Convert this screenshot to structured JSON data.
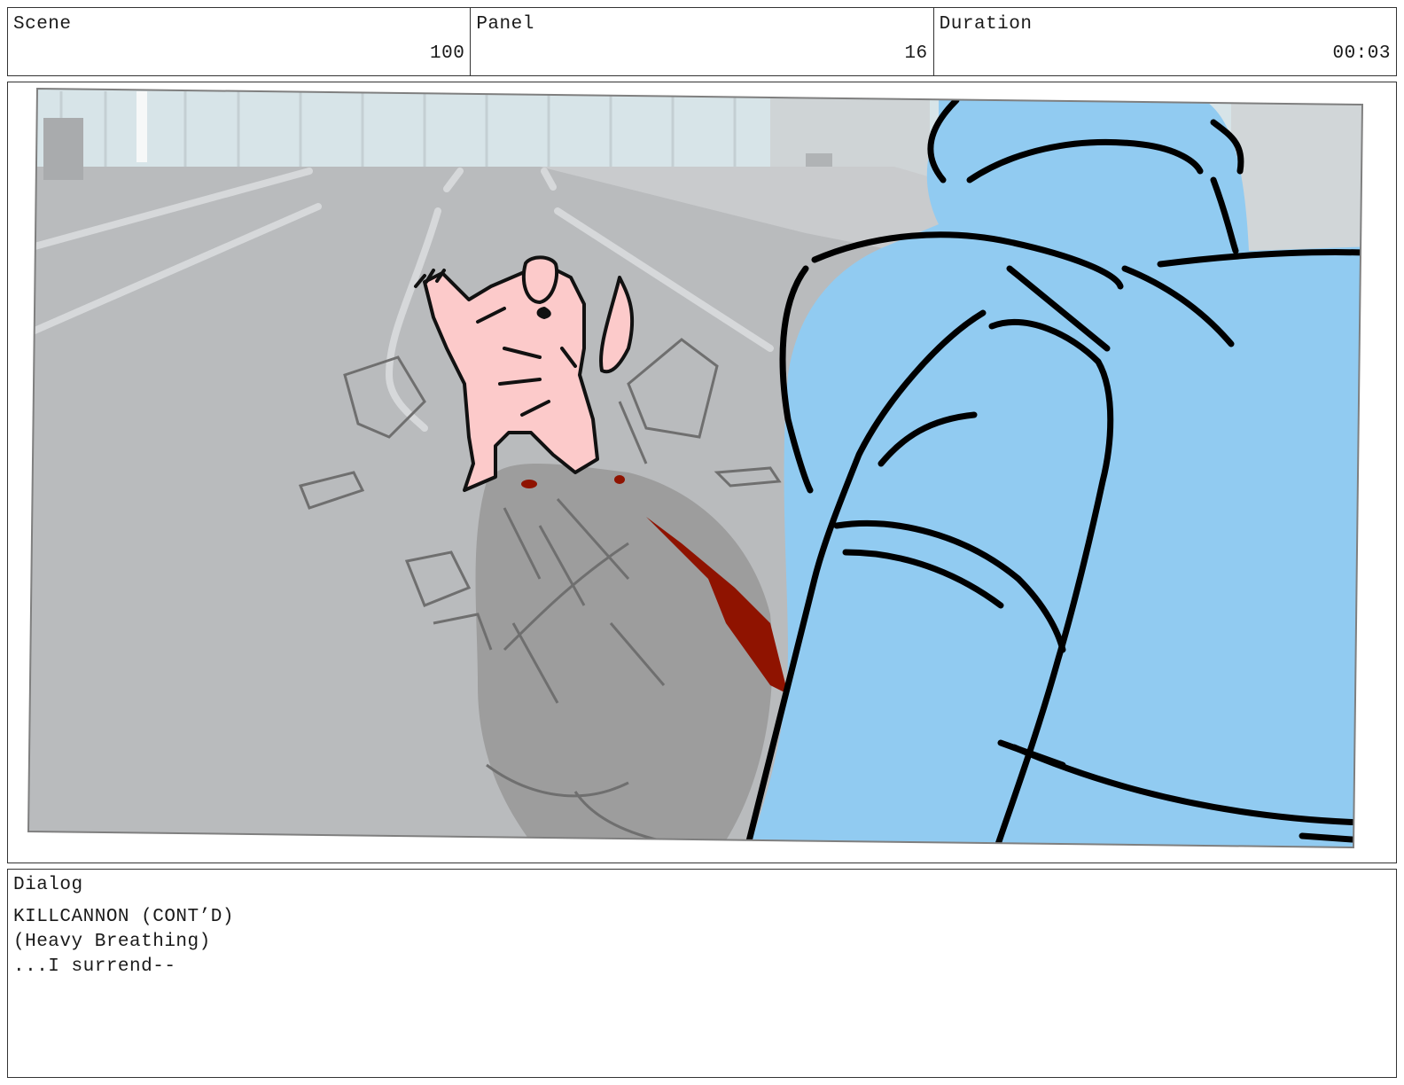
{
  "header": {
    "scene_label": "Scene",
    "scene_value": "100",
    "panel_label": "Panel",
    "panel_value": "16",
    "duration_label": "Duration",
    "duration_value": "00:03"
  },
  "dialog": {
    "label": "Dialog",
    "lines": [
      "KILLCANNON (CONT’D)",
      "(Heavy Breathing)",
      "...I surrend--"
    ]
  },
  "colors": {
    "sky": "#d7e4e8",
    "road": "#b9bbbd",
    "crater": "#9d9d9d",
    "figure": "#fccaca",
    "foreground_character": "#91cbf1",
    "blood": "#8f1300"
  }
}
